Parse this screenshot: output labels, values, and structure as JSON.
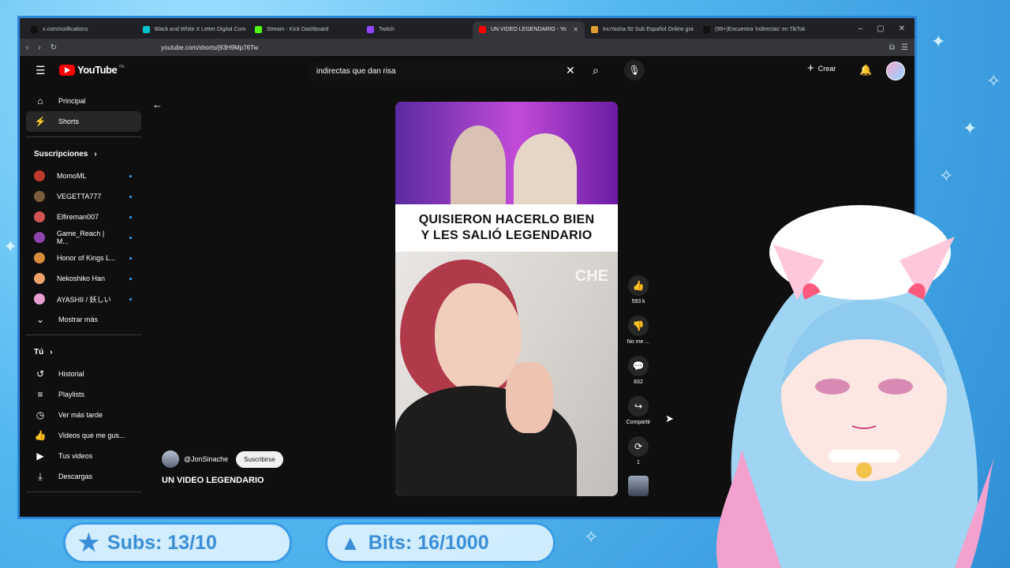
{
  "browser": {
    "tabs": [
      {
        "label": "x.com/notifications",
        "icon": "x-logo-icon",
        "color": "#111111",
        "active": false
      },
      {
        "label": "Black and White X Letter Digital Com",
        "icon": "canva-icon",
        "color": "#00c4cc",
        "active": false
      },
      {
        "label": "Stream - Kick Dashboard",
        "icon": "kick-icon",
        "color": "#53fc18",
        "active": false
      },
      {
        "label": "Twitch",
        "icon": "twitch-icon",
        "color": "#9146ff",
        "active": false
      },
      {
        "label": "UN VIDEO LEGENDARIO - Yo",
        "icon": "youtube-icon",
        "color": "#ff0000",
        "active": true
      },
      {
        "label": "InuYasha 50 Sub Español Online gra",
        "icon": "inuyasha-icon",
        "color": "#e0a030",
        "active": false
      },
      {
        "label": "(99+)Encuentra 'indirectas' en TikTok",
        "icon": "tiktok-icon",
        "color": "#111111",
        "active": false
      }
    ],
    "url": "youtube.com/shorts/j93H9Mp76Tw"
  },
  "youtube": {
    "logo_text": "YouTube",
    "logo_region": "PE",
    "search_value": "indirectas que dan risa",
    "create_label": "Crear"
  },
  "sidebar": {
    "main": [
      {
        "label": "Principal",
        "icon": "home-icon",
        "active": false
      },
      {
        "label": "Shorts",
        "icon": "shorts-icon",
        "active": true
      }
    ],
    "subs_heading": "Suscripciones",
    "subscriptions": [
      {
        "label": "MomoML",
        "color": "#c0392b"
      },
      {
        "label": "VEGETTA777",
        "color": "#7a5c3a"
      },
      {
        "label": "Elfireman007",
        "color": "#d35454"
      },
      {
        "label": "Game_Reach | M...",
        "color": "#8e44ad"
      },
      {
        "label": "Honor of Kings L...",
        "color": "#d98c3a"
      },
      {
        "label": "Nekoshiko Han",
        "color": "#f0a36b"
      },
      {
        "label": "AYASHII / 妖しい",
        "color": "#e6a0d0"
      }
    ],
    "show_more": "Mostrar más",
    "you_heading": "Tú",
    "you_items": [
      {
        "label": "Historial",
        "icon": "history-icon"
      },
      {
        "label": "Playlists",
        "icon": "playlists-icon"
      },
      {
        "label": "Ver más tarde",
        "icon": "watch-later-icon"
      },
      {
        "label": "Videos que me gus...",
        "icon": "liked-videos-icon"
      },
      {
        "label": "Tus videos",
        "icon": "your-videos-icon"
      },
      {
        "label": "Descargas",
        "icon": "downloads-icon"
      }
    ]
  },
  "short": {
    "caption_line1": "QUISIERON HACERLO BIEN",
    "caption_line2": "Y LES SALIÓ LEGENDARIO",
    "watermark": "CHE",
    "channel": "@JonSinache",
    "subscribe_label": "Suscribirse",
    "title": "UN VIDEO LEGENDARIO"
  },
  "actions": {
    "likes": "593 k",
    "dislike_label": "No me ...",
    "comments": "832",
    "share_label": "Compartir",
    "remix_count": "1"
  },
  "overlay": {
    "subs": "Subs: 13/10",
    "bits": "Bits: 16/1000"
  }
}
